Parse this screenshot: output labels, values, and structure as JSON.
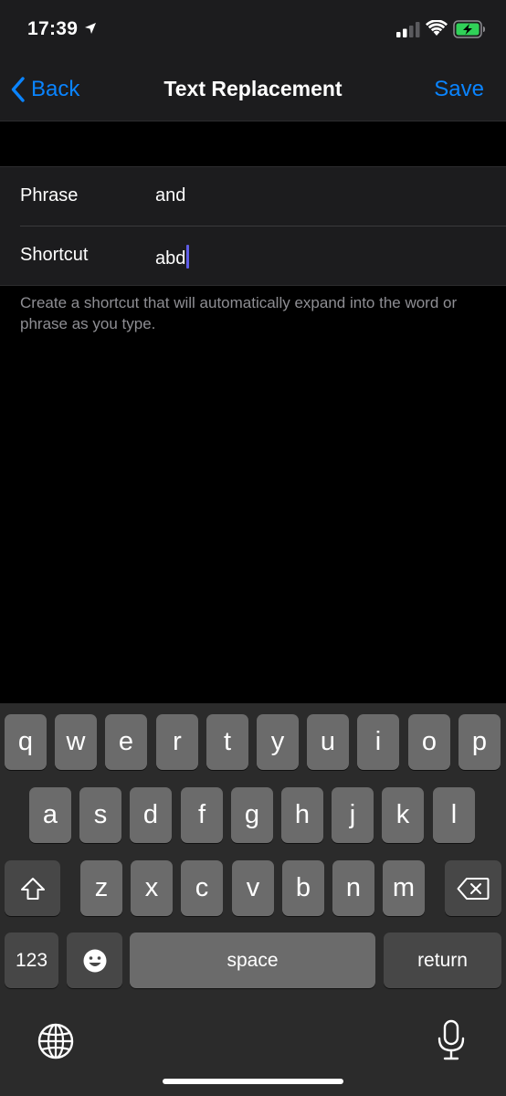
{
  "status_bar": {
    "time": "17:39",
    "icons": [
      "location-arrow-icon",
      "signal-icon",
      "wifi-icon",
      "battery-charging-icon"
    ]
  },
  "nav": {
    "back_label": "Back",
    "title": "Text Replacement",
    "save_label": "Save"
  },
  "form": {
    "phrase_label": "Phrase",
    "phrase_value": "and",
    "shortcut_label": "Shortcut",
    "shortcut_value": "abd"
  },
  "footer": "Create a shortcut that will automatically expand into the word or phrase as you type.",
  "keyboard": {
    "row1": [
      "q",
      "w",
      "e",
      "r",
      "t",
      "y",
      "u",
      "i",
      "o",
      "p"
    ],
    "row2": [
      "a",
      "s",
      "d",
      "f",
      "g",
      "h",
      "j",
      "k",
      "l"
    ],
    "row3": [
      "z",
      "x",
      "c",
      "v",
      "b",
      "n",
      "m"
    ],
    "numbers_label": "123",
    "space_label": "space",
    "return_label": "return"
  },
  "colors": {
    "accent": "#0a84ff",
    "cursor": "#5e5ce6",
    "background": "#000000",
    "grouped_background": "#1c1c1e",
    "secondary_text": "#8e8e93"
  }
}
